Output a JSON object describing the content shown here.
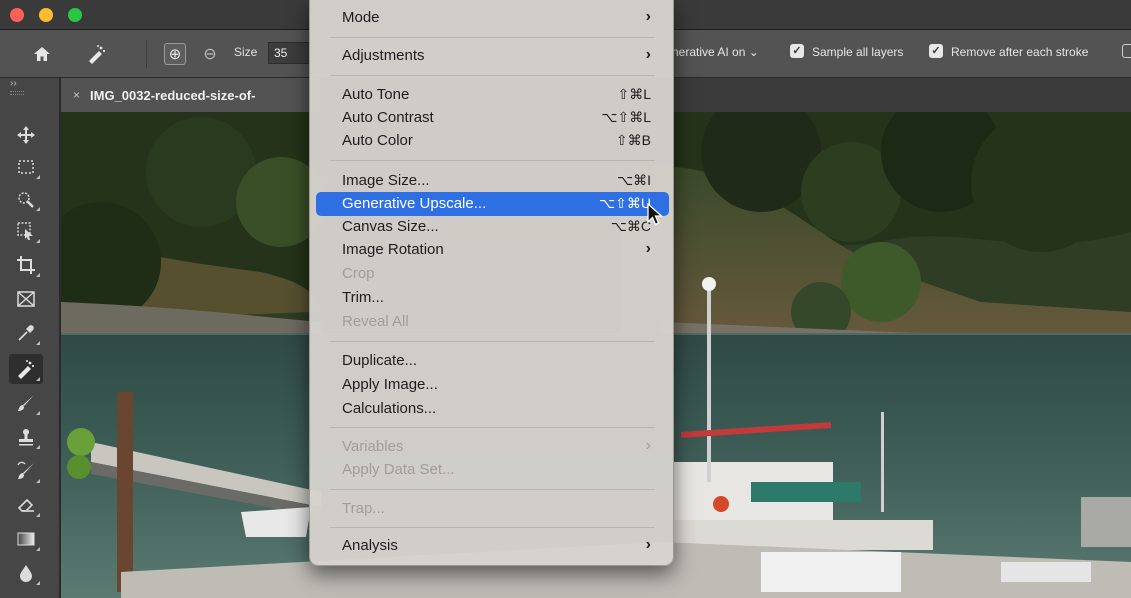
{
  "options_bar": {
    "size_label": "Size",
    "size_value": "35",
    "gen_ai_label": "nerative AI on ⌄",
    "sample_all_layers": {
      "label": "Sample all layers",
      "checked": true
    },
    "remove_after_stroke": {
      "label": "Remove after each stroke",
      "checked": true
    },
    "add_icon": "⊕",
    "subtract_icon": "⊖"
  },
  "tools": {
    "collapse": "››"
  },
  "document": {
    "close_glyph": "×",
    "tab_title": "IMG_0032-reduced-size-of-"
  },
  "menu": {
    "mode": {
      "label": "Mode",
      "arrow": "›"
    },
    "adjustments": {
      "label": "Adjustments",
      "arrow": "›"
    },
    "auto_tone": {
      "label": "Auto Tone",
      "shortcut": "⇧⌘L"
    },
    "auto_contrast": {
      "label": "Auto Contrast",
      "shortcut": "⌥⇧⌘L"
    },
    "auto_color": {
      "label": "Auto Color",
      "shortcut": "⇧⌘B"
    },
    "image_size": {
      "label": "Image Size...",
      "shortcut": "⌥⌘I"
    },
    "generative_upscale": {
      "label": "Generative Upscale...",
      "shortcut": "⌥⇧⌘U"
    },
    "canvas_size": {
      "label": "Canvas Size...",
      "shortcut": "⌥⌘C"
    },
    "image_rotation": {
      "label": "Image Rotation",
      "arrow": "›"
    },
    "crop": {
      "label": "Crop"
    },
    "trim": {
      "label": "Trim..."
    },
    "reveal_all": {
      "label": "Reveal All"
    },
    "duplicate": {
      "label": "Duplicate..."
    },
    "apply_image": {
      "label": "Apply Image..."
    },
    "calculations": {
      "label": "Calculations..."
    },
    "variables": {
      "label": "Variables",
      "arrow": "›"
    },
    "apply_data_set": {
      "label": "Apply Data Set..."
    },
    "trap": {
      "label": "Trap..."
    },
    "analysis": {
      "label": "Analysis",
      "arrow": "›"
    }
  },
  "colors": {
    "menu_highlight": "#2f6fe4",
    "menu_background": "#d6d2ce",
    "toolbar": "#535353",
    "tool_panel": "#464646"
  }
}
